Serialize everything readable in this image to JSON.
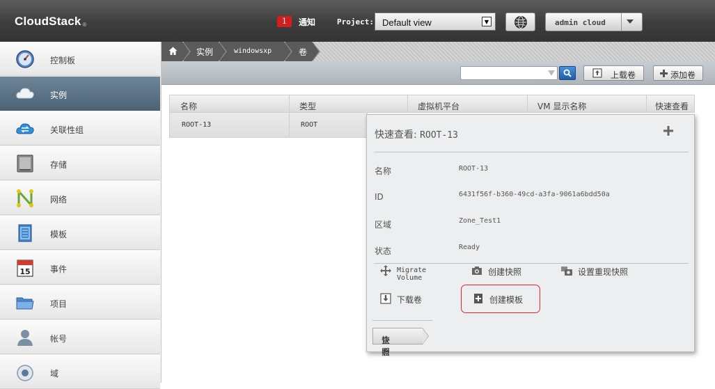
{
  "header": {
    "logo": "CloudStack",
    "logo_mark": "®",
    "notification_count": "1",
    "notification_label": "通知",
    "project_label": "Project:",
    "project_value": "Default view",
    "user": "admin cloud"
  },
  "sidebar": {
    "items": [
      {
        "label": "控制板",
        "icon": "dashboard-icon"
      },
      {
        "label": "实例",
        "icon": "cloud-icon"
      },
      {
        "label": "关联性组",
        "icon": "affinity-group-icon"
      },
      {
        "label": "存储",
        "icon": "storage-icon"
      },
      {
        "label": "网络",
        "icon": "network-icon"
      },
      {
        "label": "模板",
        "icon": "template-icon"
      },
      {
        "label": "事件",
        "icon": "calendar-icon"
      },
      {
        "label": "项目",
        "icon": "folder-icon"
      },
      {
        "label": "帐号",
        "icon": "user-icon"
      },
      {
        "label": "域",
        "icon": "domain-icon"
      }
    ],
    "active_index": 1
  },
  "breadcrumb": {
    "home_icon": "home-icon",
    "items": [
      "实例",
      "windowsxp",
      "卷"
    ]
  },
  "toolbar": {
    "search_placeholder": "",
    "upload_label": "上载卷",
    "add_label": "添加卷"
  },
  "table": {
    "columns": [
      "名称",
      "类型",
      "虚拟机平台",
      "VM 显示名称",
      "快速查看"
    ],
    "rows": [
      {
        "name": "ROOT-13",
        "type": "ROOT"
      }
    ]
  },
  "quickview": {
    "title_prefix": "快速查看: ",
    "title_id": "ROOT-13",
    "fields": [
      {
        "key": "名称",
        "value": "ROOT-13"
      },
      {
        "key": "ID",
        "value": "6431f56f-b360-49cd-a3fa-9061a6bdd50a"
      },
      {
        "key": "区域",
        "value": "Zone_Test1"
      },
      {
        "key": "状态",
        "value": "Ready"
      }
    ],
    "actions": {
      "migrate_line1": "Migrate",
      "migrate_line2": "Volume",
      "snapshot": "创建快照",
      "recurring_snapshot": "设置重现快照",
      "download": "下载卷",
      "create_template": "创建模板"
    },
    "view_label": "查看",
    "view_link": "快照"
  },
  "colors": {
    "header_bg": "#3d3d3d",
    "sidebar_active": "#5a7084",
    "highlight_border": "#e3262a",
    "notification_badge": "#d21e1e"
  }
}
